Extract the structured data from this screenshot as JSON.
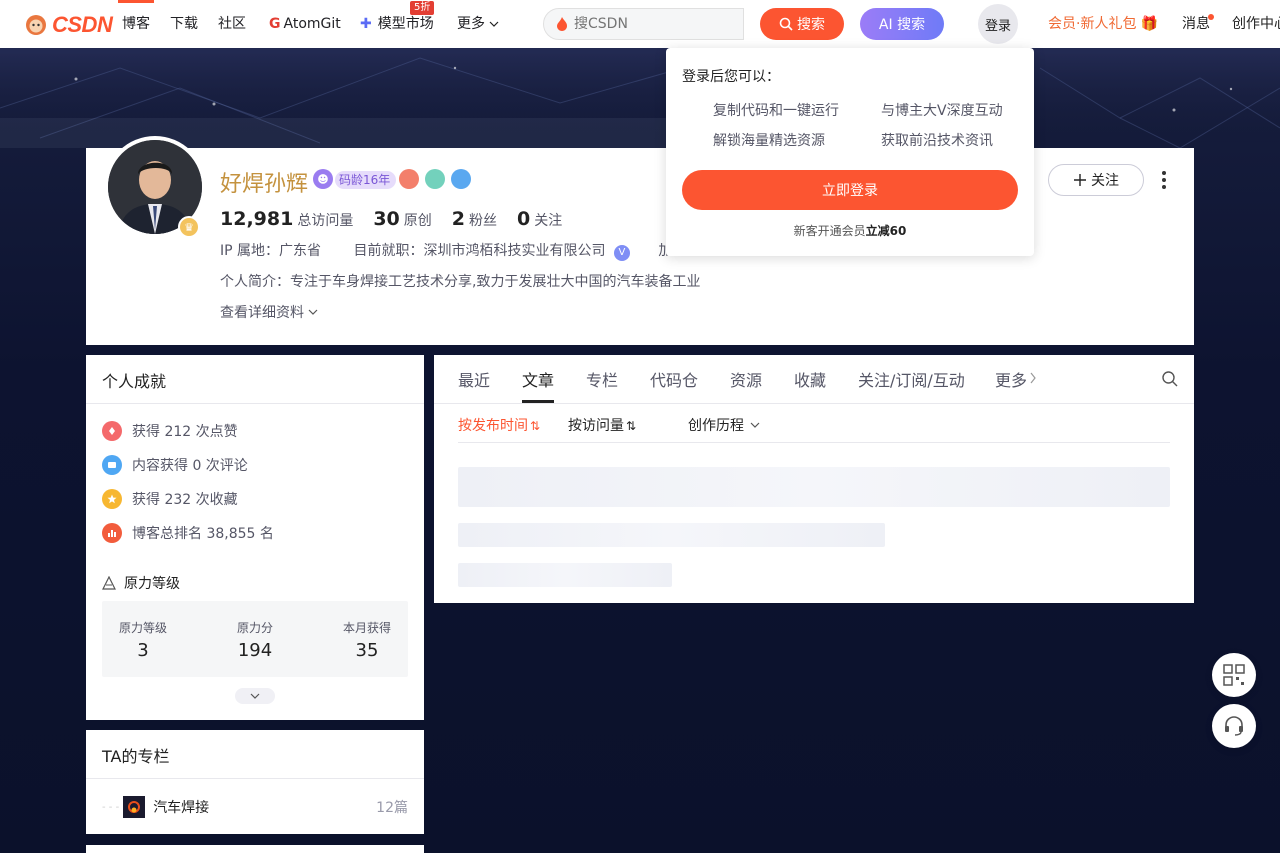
{
  "header": {
    "logo_text": "CSDN",
    "nav": [
      "博客",
      "下载",
      "社区",
      "AtomGit",
      "模型市场",
      "更多"
    ],
    "nav_badge": "5折",
    "search_placeholder": "搜CSDN",
    "search_label": "搜索",
    "ai_search_label": "AI 搜索",
    "login_label": "登录",
    "vip_label": "会员·新人礼包",
    "message_label": "消息",
    "create_label": "创作中心"
  },
  "login_popup": {
    "title": "登录后您可以：",
    "features": [
      "复制代码和一键运行",
      "与博主大V深度互动",
      "解锁海量精选资源",
      "获取前沿技术资讯"
    ],
    "login_button": "立即登录",
    "note_prefix": "新客开通会员",
    "note_bold": "立减60"
  },
  "profile": {
    "name": "好焊孙辉",
    "code_age": "码龄16年",
    "stats": [
      {
        "value": "12,981",
        "label": "总访问量"
      },
      {
        "value": "30",
        "label": "原创"
      },
      {
        "value": "2",
        "label": "粉丝"
      },
      {
        "value": "0",
        "label": "关注"
      }
    ],
    "ip": "IP 属地：广东省",
    "job": "目前就职：深圳市鸿栢科技实业有限公司",
    "job_extra": "加",
    "bio": "个人简介：专注于车身焊接工艺技术分享,致力于发展壮大中国的汽车装备工业",
    "more_info": "查看详细资料",
    "follow_label": "关注"
  },
  "achievements": {
    "title": "个人成就",
    "items": [
      {
        "text": "获得 212 次点赞",
        "color": "#f4696b"
      },
      {
        "text": "内容获得 0 次评论",
        "color": "#4fa7f3"
      },
      {
        "text": "获得 232 次收藏",
        "color": "#f7b731"
      },
      {
        "text": "博客总排名 38,855 名",
        "color": "#f25c3c"
      }
    ],
    "level_title": "原力等级",
    "level": [
      {
        "label": "原力等级",
        "value": "3"
      },
      {
        "label": "原力分",
        "value": "194"
      },
      {
        "label": "本月获得",
        "value": "35"
      }
    ]
  },
  "columns": {
    "title": "TA的专栏",
    "items": [
      {
        "name": "汽车焊接",
        "count": "12篇"
      }
    ]
  },
  "tabs": {
    "items": [
      "最近",
      "文章",
      "专栏",
      "代码仓",
      "资源",
      "收藏",
      "关注/订阅/互动",
      "更多"
    ],
    "active": "文章",
    "sub": [
      "按发布时间",
      "按访问量",
      "创作历程"
    ]
  }
}
